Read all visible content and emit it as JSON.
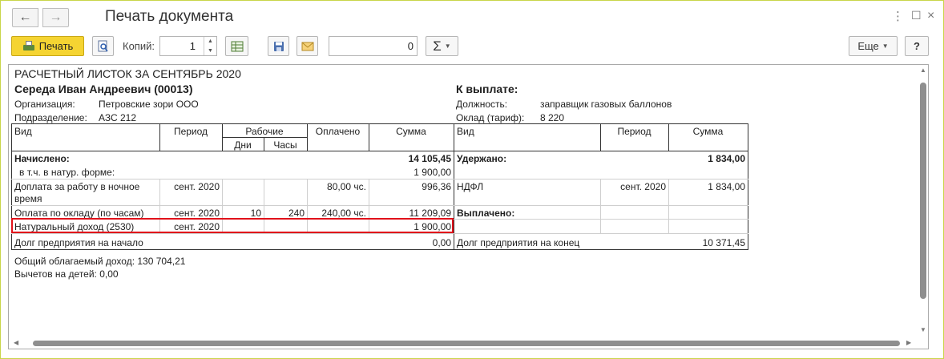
{
  "window": {
    "title": "Печать документа",
    "nav_back": "←",
    "nav_forward": "→",
    "more_icon": "⋮",
    "maximize_icon": "☐",
    "close_icon": "×"
  },
  "toolbar": {
    "print_label": "Печать",
    "copies_label": "Копий:",
    "copies_value": "1",
    "sum_value": "0",
    "sigma_label": "Σ",
    "more_label": "Еще",
    "help_label": "?"
  },
  "payslip": {
    "title": "РАСЧЕТНЫЙ ЛИСТОК ЗА СЕНТЯБРЬ 2020",
    "employee": "Середа Иван Андреевич (00013)",
    "to_pay_label": "К выплате:",
    "org_label": "Организация:",
    "org_value": "Петровские зори ООО",
    "dept_label": "Подразделение:",
    "dept_value": "АЗС 212",
    "position_label": "Должность:",
    "position_value": "заправщик газовых баллонов",
    "salary_label": "Оклад (тариф):",
    "salary_value": "8 220",
    "headers": {
      "type": "Вид",
      "period": "Период",
      "work": "Рабочие",
      "days": "Дни",
      "hours": "Часы",
      "paid": "Оплачено",
      "sum": "Сумма",
      "type_r": "Вид",
      "period_r": "Период",
      "sum_r": "Сумма"
    },
    "accrued_label": "Начислено:",
    "accrued_total": "14 105,45",
    "in_kind_label": "в т.ч. в натур. форме:",
    "in_kind_value": "1 900,00",
    "withheld_label": "Удержано:",
    "withheld_total": "1 834,00",
    "rows": [
      {
        "type": "Доплата за работу в ночное",
        "type2": "время",
        "period": "сент. 2020",
        "days": "",
        "hours": "",
        "paid": "80,00 чс.",
        "sum": "996,36"
      },
      {
        "type": "Оплата по окладу (по часам)",
        "period": "сент. 2020",
        "days": "10",
        "hours": "240",
        "paid": "240,00 чс.",
        "sum": "11 209,09"
      },
      {
        "type": "Натуральный доход (2530)",
        "period": "сент. 2020",
        "days": "",
        "hours": "",
        "paid": "",
        "sum": "1 900,00"
      }
    ],
    "ndfl": {
      "type": "НДФЛ",
      "period": "сент. 2020",
      "sum": "1 834,00"
    },
    "paid_out_label": "Выплачено:",
    "debt_start_label": "Долг предприятия на начало",
    "debt_start_value": "0,00",
    "debt_end_label": "Долг предприятия на конец",
    "debt_end_value": "10 371,45",
    "taxable_income": "Общий облагаемый доход: 130 704,21",
    "child_deductions": "Вычетов на детей: 0,00"
  },
  "colors": {
    "accent_print": "#f5d432",
    "highlight": "#e1121b",
    "window_border": "#c9d64a"
  }
}
